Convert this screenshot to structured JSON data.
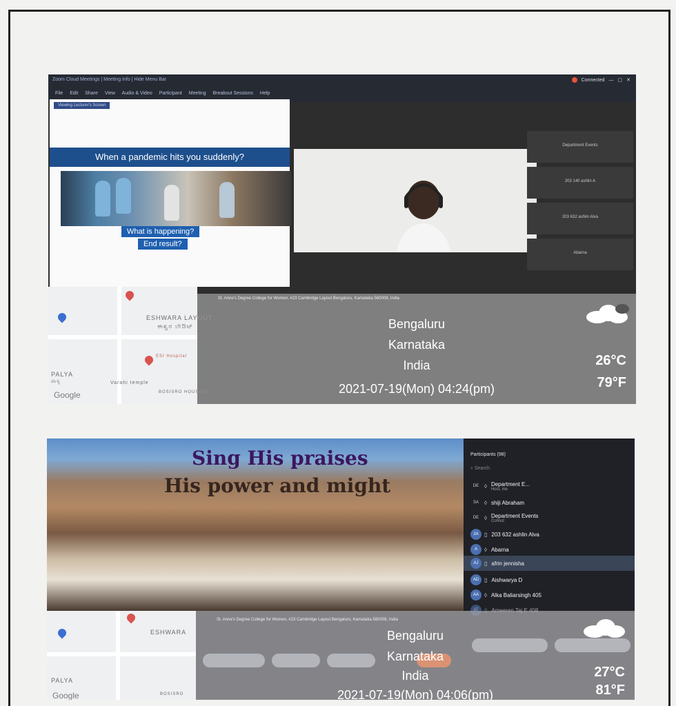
{
  "shot1": {
    "zoom": {
      "title_text": "Zoom Cloud Meetings | Meeting Info | Hide Menu Bar",
      "menu_items": [
        "File",
        "Edit",
        "Share",
        "View",
        "Audio & Video",
        "Participant",
        "Meeting",
        "Breakout Sessions",
        "Help"
      ],
      "status": "Connected",
      "presenter_tag": "Viewing Lecturer's Screen"
    },
    "slide": {
      "banner": "When a pandemic hits you suddenly?",
      "question1": "What is happening?",
      "question2": "End result?"
    },
    "side_tiles": [
      "Department Events",
      "203 140 ashlin A",
      "203 632 ashlin Alva",
      "Abarna"
    ],
    "map": {
      "area1": "ESHWARA LAYOUT",
      "area1_local": "ಈಶ್ವರ ಲೇಔಟ್",
      "area2": "PALYA",
      "area2_local": "ಪಾಳ್ಯ",
      "place1": "ESI Hospital",
      "place2": "Varahi temple",
      "place3": "BOSISRO HOUSING",
      "logo": "Google"
    },
    "geo": {
      "address": "St. Anne's Degree College for Women, #23 Cambridge Layout Bengaluru, Karnataka 560008, India",
      "city": "Bengaluru",
      "state": "Karnataka",
      "country": "India",
      "datetime": "2021-07-19(Mon)   04:24(pm)",
      "temp_c": "26°C",
      "temp_f": "79°F"
    }
  },
  "shot2": {
    "slide": {
      "title": "Sing His praises",
      "subtitle": "His power and might"
    },
    "participants": {
      "header": "Participants (98)",
      "search_placeholder": "Search",
      "rows": [
        {
          "initials": "DE",
          "name": "Department E...",
          "sub": "Host, me"
        },
        {
          "initials": "SA",
          "name": "shiji Abraham",
          "sub": ""
        },
        {
          "initials": "DE",
          "name": "Department Events",
          "sub": "Cohost"
        },
        {
          "initials": "2A",
          "name": "203 632 ashlin Alva",
          "sub": ""
        },
        {
          "initials": "A",
          "name": "Abarna",
          "sub": ""
        },
        {
          "initials": "AJ",
          "name": "afrin jennisha",
          "sub": ""
        },
        {
          "initials": "AD",
          "name": "Aishwarya D",
          "sub": ""
        },
        {
          "initials": "AA",
          "name": "Alka Baliarsingh 405",
          "sub": ""
        },
        {
          "initials": "AT",
          "name": "Ameeren Taj E 408",
          "sub": ""
        }
      ]
    },
    "map": {
      "area1": "ESHWARA",
      "area2": "PALYA",
      "place3": "BOSISRO",
      "logo": "Google"
    },
    "geo": {
      "address": "St. Anne's Degree College for Women, #23 Cambridge Layout Bengaluru, Karnataka 560008, India",
      "city": "Bengaluru",
      "state": "Karnataka",
      "country": "India",
      "datetime": "2021-07-19(Mon)   04:06(pm)",
      "temp_c": "27°C",
      "temp_f": "81°F"
    }
  }
}
